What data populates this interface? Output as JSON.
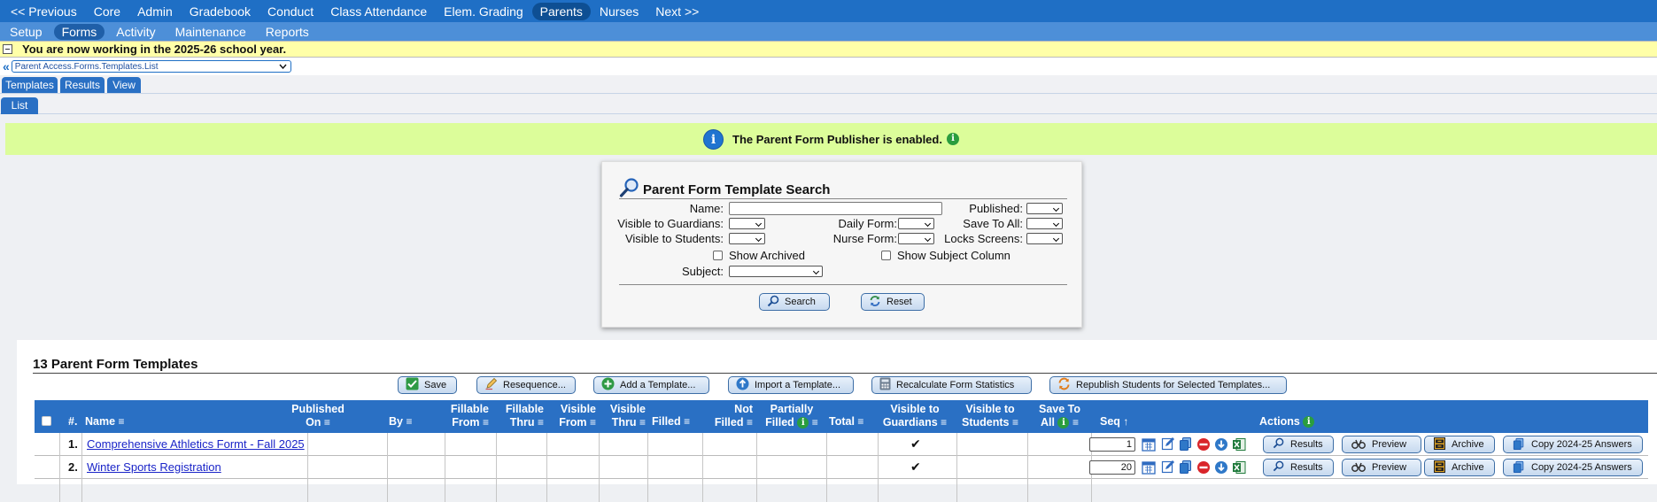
{
  "topnav": [
    {
      "label": "<< Previous",
      "active": false
    },
    {
      "label": "Core",
      "active": false
    },
    {
      "label": "Admin",
      "active": false
    },
    {
      "label": "Gradebook",
      "active": false
    },
    {
      "label": "Conduct",
      "active": false
    },
    {
      "label": "Class Attendance",
      "active": false
    },
    {
      "label": "Elem. Grading",
      "active": false
    },
    {
      "label": "Parents",
      "active": true
    },
    {
      "label": "Nurses",
      "active": false
    },
    {
      "label": "Next >>",
      "active": false
    }
  ],
  "subnav": [
    {
      "label": "Setup",
      "active": false
    },
    {
      "label": "Forms",
      "active": true
    },
    {
      "label": "Activity",
      "active": false
    },
    {
      "label": "Maintenance",
      "active": false
    },
    {
      "label": "Reports",
      "active": false
    }
  ],
  "year_notice": "You are now working in the 2025-26 school year.",
  "path": {
    "back": "«",
    "value": "Parent Access.Forms.Templates.List"
  },
  "tabs": [
    "Templates",
    "Results",
    "View"
  ],
  "subtabs": [
    "List"
  ],
  "notice": {
    "text": "The Parent Form Publisher is enabled.",
    "icon": "info-icon"
  },
  "search": {
    "title": "Parent Form Template Search",
    "name_label": "Name:",
    "published_label": "Published:",
    "guardians_label": "Visible to Guardians:",
    "daily_label": "Daily Form:",
    "saveall_label": "Save To All:",
    "students_label": "Visible to Students:",
    "nurse_label": "Nurse Form:",
    "locks_label": "Locks Screens:",
    "archived_label": "Show Archived",
    "subject_col_label": "Show Subject Column",
    "subject_label": "Subject:",
    "search_button": "Search",
    "reset_button": "Reset"
  },
  "list": {
    "title": "13 Parent Form Templates",
    "buttons": {
      "save": "Save",
      "resequence": "Resequence...",
      "add": "Add a Template...",
      "import": "Import a Template...",
      "recalc": "Recalculate Form Statistics",
      "republish": "Republish Students for Selected Templates..."
    },
    "headers": {
      "num": "#.",
      "name": "Name",
      "published_on_1": "Published",
      "published_on_2": "On",
      "by": "By",
      "fillable_from_1": "Fillable",
      "fillable_from_2": "From",
      "fillable_thru_1": "Fillable",
      "fillable_thru_2": "Thru",
      "visible_from_1": "Visible",
      "visible_from_2": "From",
      "visible_thru_1": "Visible",
      "visible_thru_2": "Thru",
      "filled": "Filled",
      "not_filled_1": "Not",
      "not_filled_2": "Filled",
      "partially_1": "Partially",
      "partially_2": "Filled",
      "total": "Total",
      "vis_guardians_1": "Visible to",
      "vis_guardians_2": "Guardians",
      "vis_students_1": "Visible to",
      "vis_students_2": "Students",
      "save_all_1": "Save To",
      "save_all_2": "All",
      "seq": "Seq",
      "actions": "Actions",
      "menu_glyph": "≡",
      "sort_glyph": "↑"
    },
    "rows": [
      {
        "num": "1.",
        "name": "Comprehensive Athletics Formt - Fall 2025",
        "guardians": "✔",
        "seq": "1",
        "results": "Results",
        "preview": "Preview",
        "archive": "Archive",
        "copy": "Copy 2024-25 Answers"
      },
      {
        "num": "2.",
        "name": "Winter Sports Registration",
        "guardians": "✔",
        "seq": "20",
        "results": "Results",
        "preview": "Preview",
        "archive": "Archive",
        "copy": "Copy 2024-25 Answers"
      }
    ]
  }
}
